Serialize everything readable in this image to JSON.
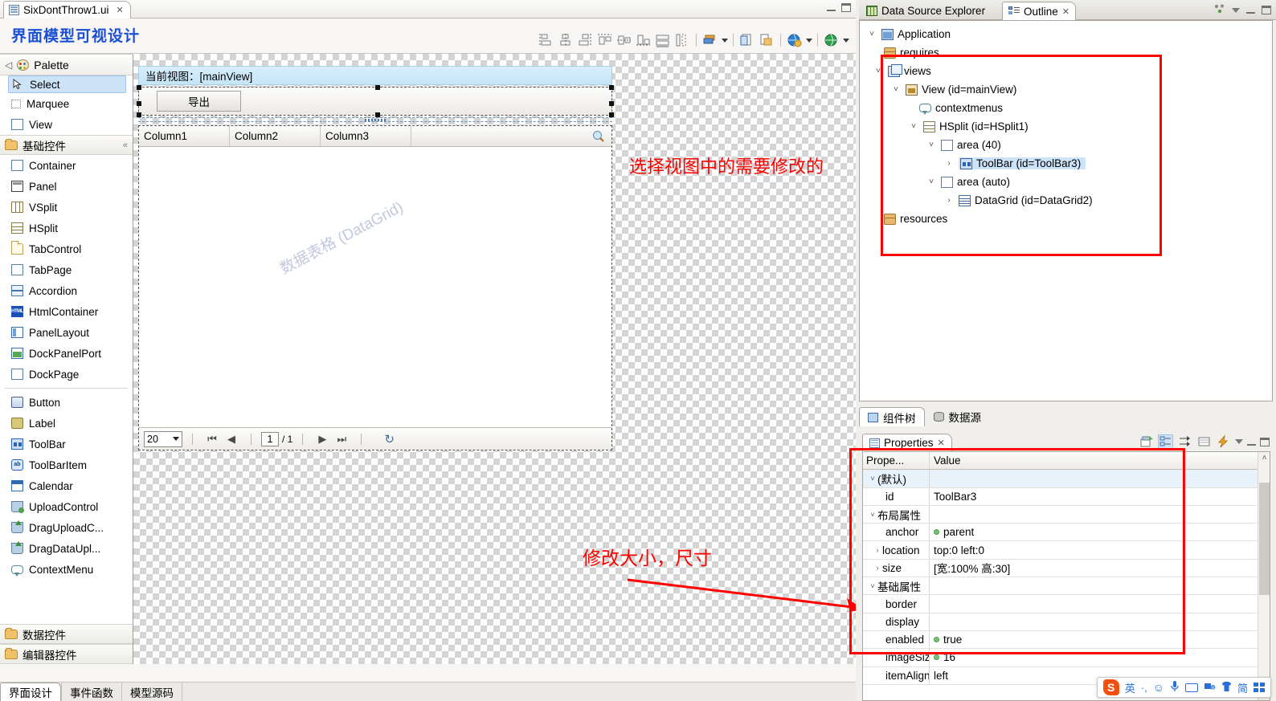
{
  "editor": {
    "tab": {
      "label": "SixDontThrow1.ui",
      "close": "✕",
      "icon": "file-ui-icon"
    },
    "title": "界面模型可视设计",
    "window_buttons": {
      "minimize": "minimize-icon",
      "maximize": "maximize-icon"
    },
    "toolbar_icons": [
      "align-left-icon",
      "align-center-icon",
      "align-right-icon",
      "align-top-icon",
      "align-middle-icon",
      "align-bottom-icon",
      "distribute-horizontal-icon",
      "distribute-vertical-icon",
      "layer-order-icon",
      "layer-order-caret",
      "copy-style-icon",
      "paste-style-icon",
      "preview-browser-icon",
      "preview-caret",
      "publish-icon",
      "publish-caret"
    ]
  },
  "palette": {
    "header": {
      "label": "Palette",
      "collapse": "◁"
    },
    "tools": [
      {
        "label": "Select",
        "icon": "cursor-icon",
        "selected": true
      },
      {
        "label": "Marquee",
        "icon": "marquee-icon",
        "selected": false
      },
      {
        "label": "View",
        "icon": "view-box-icon",
        "selected": false
      }
    ],
    "groups": [
      {
        "label": "基础控件",
        "expanded": true,
        "items": [
          {
            "label": "Container",
            "icon": "container-icon"
          },
          {
            "label": "Panel",
            "icon": "panel-icon"
          },
          {
            "label": "VSplit",
            "icon": "vsplit-icon"
          },
          {
            "label": "HSplit",
            "icon": "hsplit-icon"
          },
          {
            "label": "TabControl",
            "icon": "tabcontrol-icon"
          },
          {
            "label": "TabPage",
            "icon": "tabpage-icon"
          },
          {
            "label": "Accordion",
            "icon": "accordion-icon"
          },
          {
            "label": "HtmlContainer",
            "icon": "html-icon"
          },
          {
            "label": "PanelLayout",
            "icon": "panellayout-icon"
          },
          {
            "label": "DockPanelPort",
            "icon": "dockpanelport-icon"
          },
          {
            "label": "DockPage",
            "icon": "dockpage-icon"
          },
          {
            "label": "Button",
            "icon": "button-icon"
          },
          {
            "label": "Label",
            "icon": "label-icon"
          },
          {
            "label": "ToolBar",
            "icon": "toolbar-icon"
          },
          {
            "label": "ToolBarItem",
            "icon": "toolbaritem-icon"
          },
          {
            "label": "Calendar",
            "icon": "calendar-icon"
          },
          {
            "label": "UploadControl",
            "icon": "upload-icon"
          },
          {
            "label": "DragUploadC...",
            "icon": "dragupload-icon"
          },
          {
            "label": "DragDataUpl...",
            "icon": "dragdataupload-icon"
          },
          {
            "label": "ContextMenu",
            "icon": "contextmenu-icon"
          }
        ]
      }
    ],
    "collapsed_groups": [
      {
        "label": "数据控件",
        "icon": "folder-icon"
      },
      {
        "label": "编辑器控件",
        "icon": "folder-icon"
      }
    ]
  },
  "editor_bottom_tabs": [
    {
      "label": "界面设计",
      "active": true
    },
    {
      "label": "事件函数",
      "active": false
    },
    {
      "label": "模型源码",
      "active": false
    }
  ],
  "canvas": {
    "view_title": "当前视图：[mainView]",
    "toolbar_button": "导出",
    "datagrid": {
      "columns": [
        "Column1",
        "Column2",
        "Column3"
      ],
      "search_icon": "magnifier-icon",
      "watermark": "数据表格 (DataGrid)",
      "pager": {
        "page_size": "20",
        "first_icon": "⏮",
        "prev_icon": "◀",
        "current_page": "1",
        "total_pages": "/ 1",
        "next_icon": "▶",
        "last_icon": "⏭",
        "refresh_icon": "refresh-icon"
      }
    }
  },
  "annotations": [
    {
      "text": "选择视图中的需要修改的",
      "color": "#ff0000"
    },
    {
      "text": "修改大小，尺寸",
      "color": "#ff0000"
    }
  ],
  "right": {
    "view_tabs": [
      {
        "label": "Data Source Explorer",
        "icon": "datasource-icon",
        "active": false
      },
      {
        "label": "Outline",
        "icon": "outline-icon",
        "active": true,
        "close": "✕"
      }
    ],
    "view_tab_icons": [
      "link-editor-icon",
      "view-menu-caret",
      "minimize-icon",
      "maximize-icon"
    ],
    "outline_tree": [
      {
        "depth": 0,
        "twisty": "v",
        "icon": "application-icon",
        "label": "Application",
        "selected": false
      },
      {
        "depth": 1,
        "twisty": "",
        "icon": "package-icon",
        "label": "requires",
        "selected": false
      },
      {
        "depth": 1,
        "twisty": "v",
        "icon": "views-icon",
        "label": "views",
        "selected": false
      },
      {
        "depth": 2,
        "twisty": "v",
        "icon": "view-icon",
        "label": "View (id=mainView)",
        "selected": false
      },
      {
        "depth": 3,
        "twisty": "",
        "icon": "contextmenu-icon",
        "label": "contextmenus",
        "selected": false
      },
      {
        "depth": 3,
        "twisty": "v",
        "icon": "hsplit-icon",
        "label": "HSplit (id=HSplit1)",
        "selected": false
      },
      {
        "depth": 4,
        "twisty": "v",
        "icon": "area-icon",
        "label": "area (40)",
        "selected": false
      },
      {
        "depth": 5,
        "twisty": ">",
        "icon": "toolbar-icon",
        "label": "ToolBar (id=ToolBar3)",
        "selected": true
      },
      {
        "depth": 4,
        "twisty": "v",
        "icon": "area-icon",
        "label": "area (auto)",
        "selected": false
      },
      {
        "depth": 5,
        "twisty": ">",
        "icon": "datagrid-icon",
        "label": "DataGrid (id=DataGrid2)",
        "selected": false
      },
      {
        "depth": 1,
        "twisty": "",
        "icon": "package-icon",
        "label": "resources",
        "selected": false
      }
    ],
    "outline_bottom_tabs": [
      {
        "label": "组件树",
        "icon": "component-tree-icon",
        "active": true
      },
      {
        "label": "数据源",
        "icon": "database-icon",
        "active": false
      }
    ],
    "properties": {
      "tab_label": "Properties",
      "tab_close": "✕",
      "toolbar_icons": [
        "new-property-icon",
        "show-categories-icon",
        "show-advanced-icon",
        "table-icon",
        "quick-icon",
        "view-menu-caret",
        "minimize-icon",
        "maximize-icon"
      ],
      "columns": [
        "Prope...",
        "Value"
      ],
      "rows": [
        {
          "twisty": "v",
          "indent": 0,
          "name": "(默认)",
          "value": "",
          "dot": false,
          "group": true,
          "selected": true
        },
        {
          "twisty": "",
          "indent": 1,
          "name": "id",
          "value": "ToolBar3",
          "dot": false
        },
        {
          "twisty": "v",
          "indent": 0,
          "name": "布局属性",
          "value": "",
          "dot": false,
          "group": true
        },
        {
          "twisty": "",
          "indent": 1,
          "name": "anchor",
          "value": "parent",
          "dot": true
        },
        {
          "twisty": ">",
          "indent": 1,
          "name": "location",
          "value": "top:0 left:0",
          "dot": false
        },
        {
          "twisty": ">",
          "indent": 1,
          "name": "size",
          "value": "[宽:100% 高:30]",
          "dot": false
        },
        {
          "twisty": "v",
          "indent": 0,
          "name": "基础属性",
          "value": "",
          "dot": false,
          "group": true
        },
        {
          "twisty": "",
          "indent": 1,
          "name": "border",
          "value": "",
          "dot": false
        },
        {
          "twisty": "",
          "indent": 1,
          "name": "display",
          "value": "",
          "dot": false
        },
        {
          "twisty": "",
          "indent": 1,
          "name": "enabled",
          "value": "true",
          "dot": true
        },
        {
          "twisty": "",
          "indent": 1,
          "name": "imageSize",
          "value": "16",
          "dot": true
        },
        {
          "twisty": "",
          "indent": 1,
          "name": "itemAlign",
          "value": "left",
          "dot": false
        }
      ]
    }
  },
  "ime": {
    "logo": "S",
    "items": [
      "英",
      "·,",
      "☺",
      "🎤",
      "keyboard-icon",
      "toolbox-icon",
      "skin-icon",
      "简",
      "apps-icon"
    ]
  }
}
